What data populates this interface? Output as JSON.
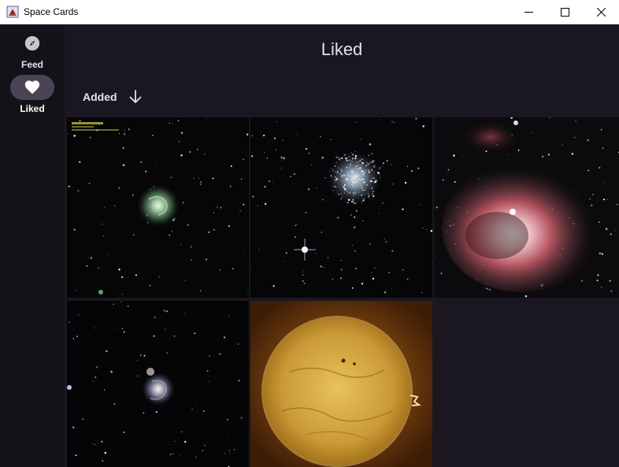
{
  "window": {
    "title": "Space Cards"
  },
  "sidebar": {
    "items": [
      {
        "label": "Feed",
        "icon": "compass-icon",
        "selected": false
      },
      {
        "label": "Liked",
        "icon": "heart-icon",
        "selected": true
      }
    ]
  },
  "page": {
    "title": "Liked"
  },
  "sort": {
    "label": "Added",
    "direction_icon": "arrow-down-icon"
  },
  "gallery": {
    "images": [
      {
        "subject": "spiral galaxy"
      },
      {
        "subject": "globular cluster"
      },
      {
        "subject": "nebula"
      },
      {
        "subject": "whirlpool galaxy"
      },
      {
        "subject": "sun"
      }
    ]
  },
  "colors": {
    "background": "#1a1720",
    "sidebar": "#141219",
    "selected_pill": "#4a4455"
  }
}
